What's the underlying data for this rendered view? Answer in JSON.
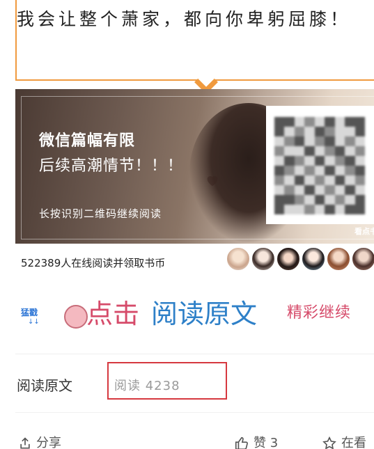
{
  "quote": {
    "text": "我会让整个萧家，都向你卑躬屈膝！"
  },
  "banner": {
    "title": "微信篇幅有限",
    "subtitle": "后续高潮情节！！！",
    "hint": "长按识别二维码继续阅读",
    "watermark": "看点书"
  },
  "readers": {
    "text": "522389人在线阅读并领取书币"
  },
  "cta": {
    "sticker": "猛戳",
    "arrows": "↓↓",
    "click": "点击",
    "read_original": "阅读原文",
    "continue": "精彩继续"
  },
  "footer": {
    "read_original_link": "阅读原文",
    "read_count": "阅读 4238",
    "share": "分享",
    "like": "赞 3",
    "favorite": "在看"
  },
  "colors": {
    "accent_orange": "#f09a3e",
    "cta_pink": "#d64b6a",
    "cta_blue": "#2e80c8",
    "highlight_red": "#d6383f"
  },
  "icons": {
    "share": "share-icon",
    "like": "thumbs-up-icon",
    "favorite": "star-icon",
    "heart": "heart-icon",
    "paw": "cat-paw-icon"
  }
}
